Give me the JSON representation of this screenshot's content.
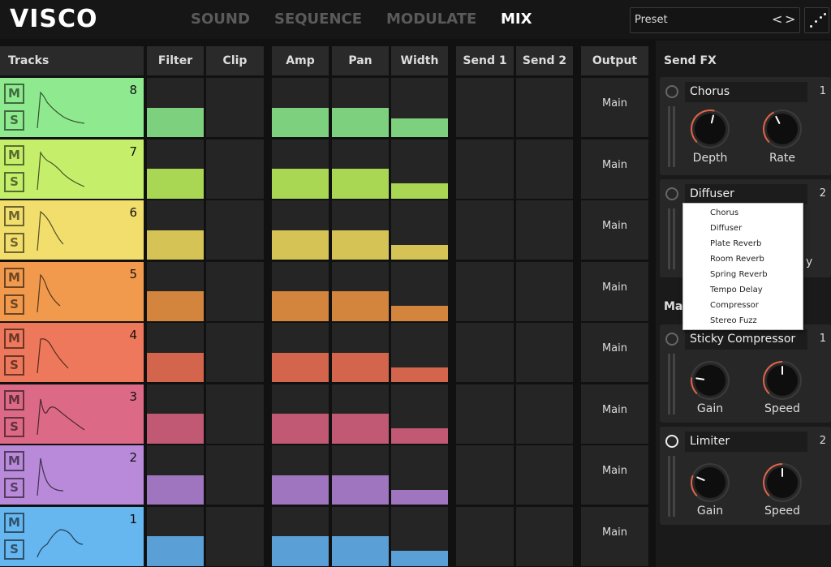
{
  "app": {
    "logo": "VISCO"
  },
  "nav": {
    "tabs": [
      {
        "label": "SOUND"
      },
      {
        "label": "SEQUENCE"
      },
      {
        "label": "MODULATE"
      },
      {
        "label": "MIX"
      }
    ],
    "active": "MIX"
  },
  "preset": {
    "label": "Preset",
    "prev": "<",
    "next": ">"
  },
  "grid": {
    "tracks_header": "Tracks",
    "columns": [
      {
        "label": "Filter"
      },
      {
        "label": "Clip"
      },
      {
        "label": "Amp"
      },
      {
        "label": "Pan"
      },
      {
        "label": "Width"
      },
      {
        "label": "Send 1"
      },
      {
        "label": "Send 2"
      },
      {
        "label": "Output"
      }
    ],
    "mute_label": "M",
    "solo_label": "S",
    "tracks": [
      {
        "number": "8",
        "color": "#8fea8f",
        "bar_color": "#7dd07d",
        "filter": 0.5,
        "amp": 0.5,
        "pan": 0.5,
        "width": 0.32,
        "output": "Main"
      },
      {
        "number": "7",
        "color": "#c5ef6a",
        "bar_color": "#a9d653",
        "filter": 0.5,
        "amp": 0.5,
        "pan": 0.5,
        "width": 0.25,
        "output": "Main"
      },
      {
        "number": "6",
        "color": "#f1de6c",
        "bar_color": "#d5c455",
        "filter": 0.5,
        "amp": 0.5,
        "pan": 0.5,
        "width": 0.25,
        "output": "Main"
      },
      {
        "number": "5",
        "color": "#f19a4d",
        "bar_color": "#d3843d",
        "filter": 0.5,
        "amp": 0.5,
        "pan": 0.5,
        "width": 0.25,
        "output": "Main"
      },
      {
        "number": "4",
        "color": "#ee785b",
        "bar_color": "#d2654c",
        "filter": 0.5,
        "amp": 0.5,
        "pan": 0.5,
        "width": 0.25,
        "output": "Main"
      },
      {
        "number": "3",
        "color": "#dc6a86",
        "bar_color": "#c15974",
        "filter": 0.5,
        "amp": 0.5,
        "pan": 0.5,
        "width": 0.25,
        "output": "Main"
      },
      {
        "number": "2",
        "color": "#b98ad9",
        "bar_color": "#9f75c0",
        "filter": 0.5,
        "amp": 0.5,
        "pan": 0.5,
        "width": 0.25,
        "output": "Main"
      },
      {
        "number": "1",
        "color": "#66b6ef",
        "bar_color": "#5a9fd6",
        "filter": 0.5,
        "amp": 0.5,
        "pan": 0.5,
        "width": 0.25,
        "output": "Main"
      }
    ]
  },
  "send_fx": {
    "title": "Send FX",
    "cards": [
      {
        "name": "Chorus",
        "number": "1",
        "knobs": [
          {
            "label": "Depth",
            "value": 0.55
          },
          {
            "label": "Rate",
            "value": 0.4
          }
        ]
      },
      {
        "name": "Diffuser",
        "number": "2",
        "partial_text": "y"
      }
    ]
  },
  "main_fx": {
    "title_partial": "Mai",
    "cards": [
      {
        "name": "Sticky Compressor",
        "number": "1",
        "knobs": [
          {
            "label": "Gain",
            "value": 0.2
          },
          {
            "label": "Speed",
            "value": 0.5
          }
        ]
      },
      {
        "name": "Limiter",
        "number": "2",
        "knobs": [
          {
            "label": "Gain",
            "value": 0.25
          },
          {
            "label": "Speed",
            "value": 0.5
          }
        ]
      }
    ]
  },
  "dropdown": {
    "items": [
      {
        "label": "Chorus"
      },
      {
        "label": "Diffuser"
      },
      {
        "label": "Plate Reverb"
      },
      {
        "label": "Room Reverb"
      },
      {
        "label": "Spring Reverb"
      },
      {
        "label": "Tempo Delay"
      },
      {
        "label": "Compressor"
      },
      {
        "label": "Stereo Fuzz"
      }
    ]
  },
  "colors": {
    "knob_arc": "#e0634a",
    "background": "#111111",
    "cell": "#252525"
  }
}
